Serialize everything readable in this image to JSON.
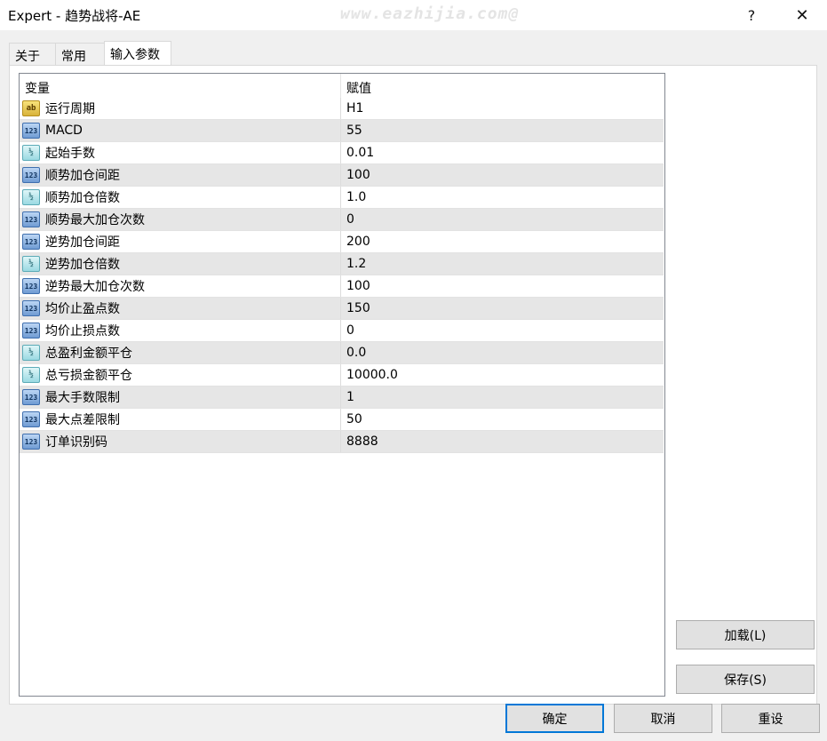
{
  "window": {
    "title": "Expert - 趋势战将-AE",
    "watermark": "www.eazhijia.com@",
    "help_label": "?",
    "close_label": "✕"
  },
  "tabs": [
    {
      "label": "关于"
    },
    {
      "label": "常用"
    },
    {
      "label": "输入参数"
    }
  ],
  "grid": {
    "headers": {
      "variable": "变量",
      "value": "赋值"
    },
    "rows": [
      {
        "name": "运行周期",
        "value": "H1",
        "type_icon": "ab"
      },
      {
        "name": "MACD",
        "value": "55",
        "type_icon": "123"
      },
      {
        "name": "起始手数",
        "value": "0.01",
        "type_icon": "½"
      },
      {
        "name": "顺势加仓间距",
        "value": "100",
        "type_icon": "123"
      },
      {
        "name": "顺势加仓倍数",
        "value": "1.0",
        "type_icon": "½"
      },
      {
        "name": "顺势最大加仓次数",
        "value": "0",
        "type_icon": "123"
      },
      {
        "name": "逆势加仓间距",
        "value": "200",
        "type_icon": "123"
      },
      {
        "name": "逆势加仓倍数",
        "value": "1.2",
        "type_icon": "½"
      },
      {
        "name": "逆势最大加仓次数",
        "value": "100",
        "type_icon": "123"
      },
      {
        "name": "均价止盈点数",
        "value": "150",
        "type_icon": "123"
      },
      {
        "name": "均价止损点数",
        "value": "0",
        "type_icon": "123"
      },
      {
        "name": "总盈利金额平仓",
        "value": "0.0",
        "type_icon": "½"
      },
      {
        "name": "总亏损金额平仓",
        "value": "10000.0",
        "type_icon": "½"
      },
      {
        "name": "最大手数限制",
        "value": "1",
        "type_icon": "123"
      },
      {
        "name": "最大点差限制",
        "value": "50",
        "type_icon": "123"
      },
      {
        "name": "订单识别码",
        "value": "8888",
        "type_icon": "123"
      }
    ]
  },
  "buttons": {
    "load": "加载(L)",
    "save": "保存(S)",
    "ok": "确定",
    "cancel": "取消",
    "reset": "重设"
  },
  "colors": {
    "accent": "#0078d7",
    "row_alt": "#e6e6e6",
    "dialog_bg": "#f0f0f0"
  }
}
